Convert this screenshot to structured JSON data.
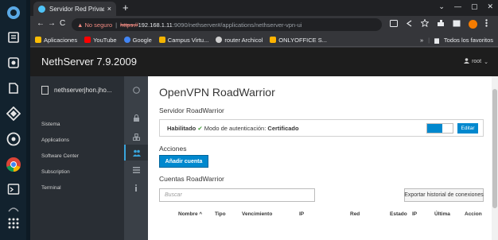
{
  "dock": {
    "items": [
      "linux-mint-logo",
      "files",
      "system-settings",
      "text-editor",
      "app-store",
      "network",
      "chrome",
      "terminal",
      "apps-grid"
    ]
  },
  "browser": {
    "tab_title": "Servidor Red Privada Vir",
    "tab_close": "×",
    "new_tab": "+",
    "win_controls": [
      "⌄",
      "—",
      "▢",
      "✕"
    ],
    "nav": {
      "back": "←",
      "forward": "→",
      "reload": "C"
    },
    "address": {
      "warning": "▲ No seguro",
      "separator": "|",
      "scheme": "https://",
      "host": "192.168.1.11",
      "path": ":9090/nethserver#/applications/nethserver-vpn-ui"
    },
    "bookmarks": [
      {
        "label": "Aplicaciones",
        "color": "#fbbc05"
      },
      {
        "label": "YouTube",
        "color": "#ff0000"
      },
      {
        "label": "Google",
        "color": "#4285f4"
      },
      {
        "label": "Campus Virtu...",
        "color": "#f4b400"
      },
      {
        "label": "router Archicol",
        "color": "#cfcfcf"
      },
      {
        "label": "ONLYOFFICE S...",
        "color": "#ffb300"
      }
    ],
    "bookmarks_more": "»",
    "all_bookmarks": "Todos los favoritos"
  },
  "ns": {
    "brand": "NethServer 7.9.2009",
    "user": "root",
    "hostname": "nethserverjhon.jho...",
    "sidebar": [
      {
        "label": "Sistema",
        "icon": "lock-icon"
      },
      {
        "label": "Applications",
        "icon": "cubes-icon"
      },
      {
        "label": "Software Center",
        "icon": "users-icon"
      },
      {
        "label": "Subscription",
        "icon": "list-icon"
      },
      {
        "label": "Terminal",
        "icon": "info-icon"
      }
    ],
    "page_title": "OpenVPN RoadWarrior",
    "server_section": "Servidor RoadWarrior",
    "status_enabled": "Habilitado",
    "status_check": "✔",
    "auth_mode_label": "Modo de autenticación:",
    "auth_mode_value": "Certificado",
    "edit_label": "Editar",
    "actions_section": "Acciones",
    "add_account_label": "Añadir cuenta",
    "accounts_section": "Cuentas RoadWarrior",
    "search_placeholder": "Buscar",
    "export_label": "Exportar historial de conexiones",
    "table_headers": [
      "Nombre ^",
      "Tipo",
      "Vencimiento",
      "IP",
      "Red",
      "Estado",
      "IP",
      "Última",
      "Accion"
    ]
  },
  "colors": {
    "accent": "#0088ce",
    "header_bg": "#1d1d1d",
    "sidebar_bg": "#292e34",
    "success": "#3f9c35"
  }
}
